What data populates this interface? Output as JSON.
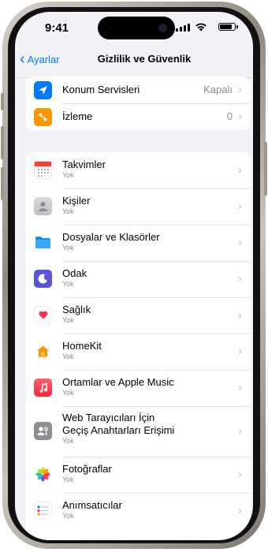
{
  "status": {
    "time": "9:41"
  },
  "nav": {
    "back_label": "Ayarlar",
    "title": "Gizlilik ve Güvenlik"
  },
  "group1": [
    {
      "label": "Konum Servisleri",
      "value": "Kapalı",
      "icon": "location-arrow-icon",
      "color": "#007aff"
    },
    {
      "label": "İzleme",
      "value": "0",
      "icon": "tracking-icon",
      "color": "#ff9500"
    }
  ],
  "group2": [
    {
      "label": "Takvimler",
      "sub": "Yok",
      "icon": "calendar-icon"
    },
    {
      "label": "Kişiler",
      "sub": "Yok",
      "icon": "contacts-icon"
    },
    {
      "label": "Dosyalar ve Klasörler",
      "sub": "Yok",
      "icon": "folder-icon"
    },
    {
      "label": "Odak",
      "sub": "Yok",
      "icon": "focus-moon-icon"
    },
    {
      "label": "Sağlık",
      "sub": "Yok",
      "icon": "health-heart-icon"
    },
    {
      "label": "HomeKit",
      "sub": "Yok",
      "icon": "homekit-icon"
    },
    {
      "label": "Ortamlar ve Apple Music",
      "sub": "Yok",
      "icon": "music-icon"
    },
    {
      "label_line1": "Web Tarayıcıları İçin",
      "label_line2": "Geçiş Anahtarları Erişimi",
      "sub": "Yok",
      "icon": "passkey-icon"
    },
    {
      "label": "Fotoğraflar",
      "sub": "Yok",
      "icon": "photos-icon"
    },
    {
      "label": "Anımsatıcılar",
      "sub": "Yok",
      "icon": "reminders-icon"
    }
  ]
}
